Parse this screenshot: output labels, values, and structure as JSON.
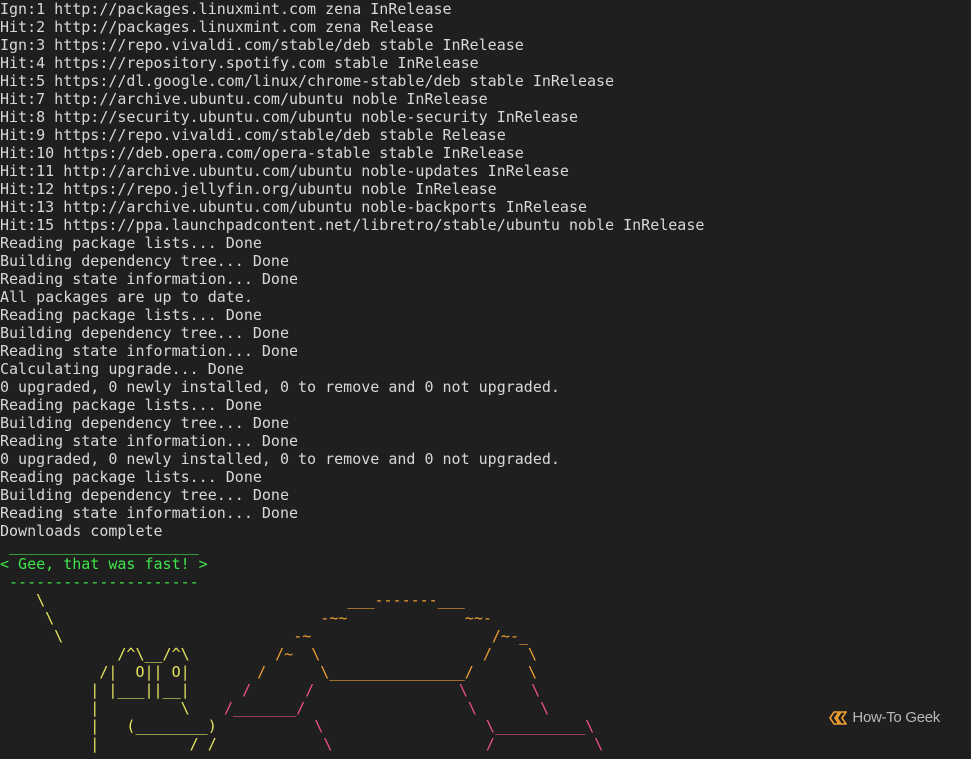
{
  "terminal": {
    "lines": [
      "Ign:1 http://packages.linuxmint.com zena InRelease",
      "Hit:2 http://packages.linuxmint.com zena Release",
      "Ign:3 https://repo.vivaldi.com/stable/deb stable InRelease",
      "Hit:4 https://repository.spotify.com stable InRelease",
      "Hit:5 https://dl.google.com/linux/chrome-stable/deb stable InRelease",
      "Hit:7 http://archive.ubuntu.com/ubuntu noble InRelease",
      "Hit:8 http://security.ubuntu.com/ubuntu noble-security InRelease",
      "Hit:9 https://repo.vivaldi.com/stable/deb stable Release",
      "Hit:10 https://deb.opera.com/opera-stable stable InRelease",
      "Hit:11 http://archive.ubuntu.com/ubuntu noble-updates InRelease",
      "Hit:12 https://repo.jellyfin.org/ubuntu noble InRelease",
      "Hit:13 http://archive.ubuntu.com/ubuntu noble-backports InRelease",
      "Hit:15 https://ppa.launchpadcontent.net/libretro/stable/ubuntu noble InRelease",
      "Reading package lists... Done",
      "Building dependency tree... Done",
      "Reading state information... Done",
      "All packages are up to date.",
      "Reading package lists... Done",
      "Building dependency tree... Done",
      "Reading state information... Done",
      "Calculating upgrade... Done",
      "0 upgraded, 0 newly installed, 0 to remove and 0 not upgraded.",
      "Reading package lists... Done",
      "Building dependency tree... Done",
      "Reading state information... Done",
      "0 upgraded, 0 newly installed, 0 to remove and 0 not upgraded.",
      "Reading package lists... Done",
      "Building dependency tree... Done",
      "Reading state information... Done",
      "Downloads complete"
    ],
    "bubble_top": " _____________________",
    "bubble_text": "< Gee, that was fast! >",
    "bubble_bottom": " ---------------------"
  },
  "watermark": {
    "text": "How-To Geek",
    "color": "#f0a030"
  },
  "colors": {
    "background": "#1f1f1f",
    "text": "#d8d8d8",
    "bubble": "#3ee64a",
    "art_yellow": "#e5e560"
  }
}
